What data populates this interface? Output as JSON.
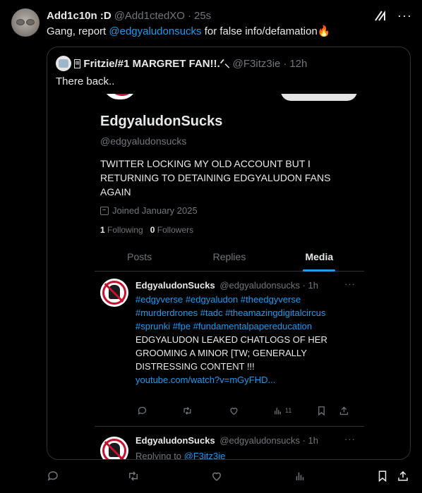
{
  "outer": {
    "name": "Add1c10n :D",
    "handle": "@Add1ctedXO",
    "separator": "·",
    "time": "25s",
    "text_before": "Gang, report ",
    "mention": "@edgyaludonsucks",
    "text_after": " for false info/defamation🔥"
  },
  "quote": {
    "badge": "⊞",
    "name": "Fritzie/#1 MARGRET FAN!!.ᐟ⸜",
    "handle": "@F3itz3ie",
    "separator": "·",
    "time": "12h",
    "text": "There back.."
  },
  "screenshot": {
    "profile": {
      "name": "EdgyaludonSucks",
      "handle": "@edgyaludonsucks",
      "bio": "TWITTER LOCKING MY OLD ACCOUNT BUT I RETURNING TO DETAINING EDGYALUDON FANS AGAIN",
      "joined": "Joined January 2025",
      "following_count": "1",
      "following_label": "Following",
      "followers_count": "0",
      "followers_label": "Followers"
    },
    "tabs": [
      {
        "label": "Posts"
      },
      {
        "label": "Replies"
      },
      {
        "label": "Media"
      }
    ],
    "posts": [
      {
        "name": "EdgyaludonSucks",
        "handle_time": "@edgyaludonsucks · 1h",
        "more": "···",
        "hashtags": "#edgyverse #edgyaludon #theedgyverse #murderdrones #tadc #theamazingdigitalcircus #sprunki #fpe #fundamentalpapereducation",
        "text": "EDGYALUDON LEAKED CHATLOGS OF HER GROOMING A MINOR [TW; GENERALLY DISTRESSING CONTENT !!!",
        "link": "youtube.com/watch?v=mGyFHD...",
        "views": "11"
      },
      {
        "name": "EdgyaludonSucks",
        "handle_time": "@edgyaludonsucks · 1h",
        "more": "···",
        "replying_to_label": "Replying to ",
        "replying_to": "@F3itz3ie"
      }
    ]
  },
  "icons": [
    "grok-icon",
    "more-icon",
    "reply-icon",
    "retweet-icon",
    "like-icon",
    "views-icon",
    "bookmark-icon",
    "share-icon",
    "calendar-icon"
  ],
  "colors": {
    "background": "#000000",
    "text": "#e7e9ea",
    "muted": "#71767b",
    "accent": "#1d9bf0",
    "border": "#2f3336"
  }
}
